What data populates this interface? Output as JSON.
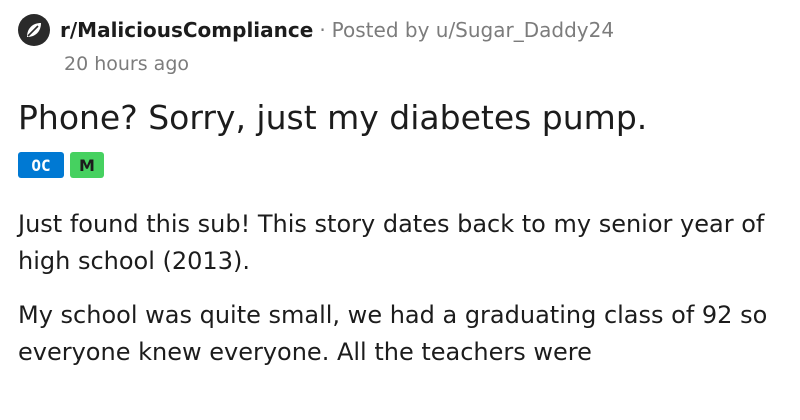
{
  "post": {
    "subreddit": "r/MaliciousCompliance",
    "separator": "·",
    "posted_by_prefix": "Posted by",
    "author": "u/Sugar_Daddy24",
    "timestamp": "20 hours ago",
    "title": "Phone? Sorry, just my diabetes pump.",
    "flairs": [
      {
        "label": "OC",
        "color": "#0079d3"
      },
      {
        "label": "M",
        "color": "#46d160"
      }
    ],
    "paragraphs": [
      "Just found this sub! This story dates back to my senior year of high school (2013).",
      "My school was quite small, we had a graduating class of 92 so everyone knew everyone. All the teachers were"
    ]
  },
  "colors": {
    "muted_text": "#7c7c7c",
    "primary_text": "#1c1c1c",
    "subreddit_icon": "#2a2a2a"
  },
  "icons": {
    "subreddit": "subreddit-icon"
  }
}
